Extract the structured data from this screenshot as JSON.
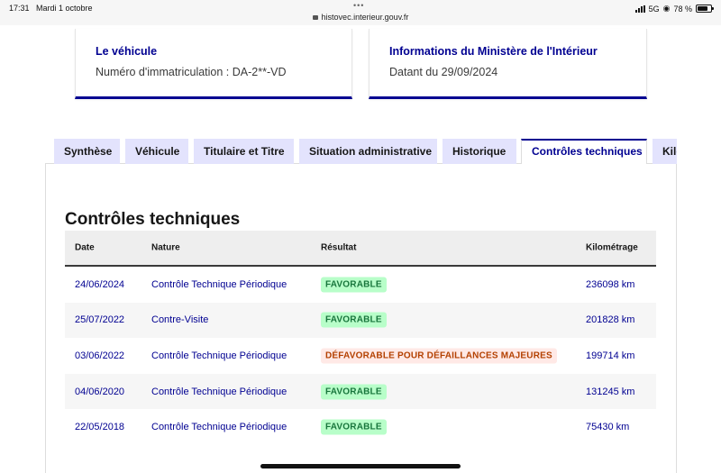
{
  "status_bar": {
    "time": "17:31",
    "date": "Mardi 1 octobre",
    "dots": "•••",
    "url": "histovec.interieur.gouv.fr",
    "network": "5G",
    "battery": "78 %",
    "battery_level": 0.78
  },
  "cards": {
    "vehicle": {
      "title": "Le véhicule",
      "text": "Numéro d'immatriculation : DA-2**-VD"
    },
    "ministry": {
      "title": "Informations du Ministère de l'Intérieur",
      "text": "Datant du 29/09/2024"
    }
  },
  "tabs": [
    {
      "label": "Synthèse",
      "active": false
    },
    {
      "label": "Véhicule",
      "active": false
    },
    {
      "label": "Titulaire et Titre",
      "active": false
    },
    {
      "label": "Situation administrative",
      "active": false
    },
    {
      "label": "Historique",
      "active": false
    },
    {
      "label": "Contrôles techniques",
      "active": true
    },
    {
      "label": "Kilométrage",
      "active": false
    }
  ],
  "section": {
    "title": "Contrôles techniques"
  },
  "table": {
    "headers": {
      "date": "Date",
      "nature": "Nature",
      "result": "Résultat",
      "km": "Kilométrage"
    },
    "rows": [
      {
        "date": "24/06/2024",
        "nature": "Contrôle Technique Périodique",
        "result": "FAVORABLE",
        "status": "ok",
        "km": "236098 km"
      },
      {
        "date": "25/07/2022",
        "nature": "Contre-Visite",
        "result": "FAVORABLE",
        "status": "ok",
        "km": "201828 km"
      },
      {
        "date": "03/06/2022",
        "nature": "Contrôle Technique Périodique",
        "result": "DÉFAVORABLE POUR DÉFAILLANCES MAJEURES",
        "status": "ko",
        "km": "199714 km"
      },
      {
        "date": "04/06/2020",
        "nature": "Contrôle Technique Périodique",
        "result": "FAVORABLE",
        "status": "ok",
        "km": "131245 km"
      },
      {
        "date": "22/05/2018",
        "nature": "Contrôle Technique Périodique",
        "result": "FAVORABLE",
        "status": "ok",
        "km": "75430 km"
      }
    ]
  },
  "colors": {
    "accent": "#000091",
    "tab_bg": "#e3e3fd",
    "success_bg": "#b8fec9",
    "success_text": "#18753c",
    "error_bg": "#ffe9e6",
    "error_text": "#b34000"
  }
}
